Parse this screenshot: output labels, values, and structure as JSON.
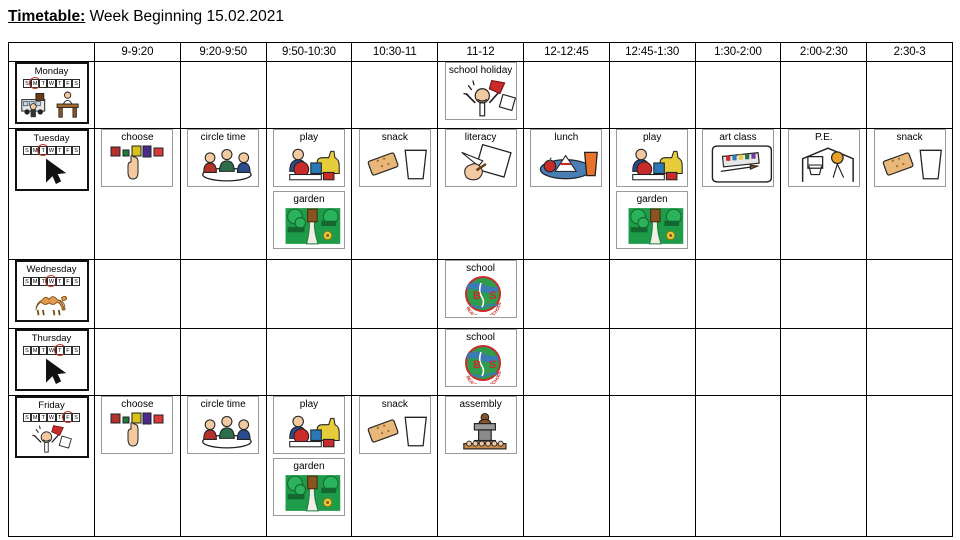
{
  "title": {
    "label": "Timetable:",
    "value": "Week Beginning 15.02.2021"
  },
  "table": {
    "corner_label": "",
    "time_slots": [
      "9-9:20",
      "9:20-9:50",
      "9:50-10:30",
      "10:30-11",
      "11-12",
      "12-12:45",
      "12:45-1:30",
      "1:30-2:00",
      "2:00-2:30",
      "2:30-3"
    ],
    "week_letters": [
      "S",
      "M",
      "T",
      "W",
      "T",
      "F",
      "S"
    ],
    "rows": [
      {
        "day": "Monday",
        "day_icon": "school-bus-and-desk-icon",
        "selected_letter_index": 1,
        "cells": [
          {
            "cards": []
          },
          {
            "cards": []
          },
          {
            "cards": []
          },
          {
            "cards": []
          },
          {
            "cards": [
              {
                "label": "school holiday",
                "icon": "celebration-icon"
              }
            ]
          },
          {
            "cards": []
          },
          {
            "cards": []
          },
          {
            "cards": []
          },
          {
            "cards": []
          },
          {
            "cards": []
          }
        ]
      },
      {
        "day": "Tuesday",
        "day_icon": "arrow-pointer-icon",
        "selected_letter_index": 2,
        "cells": [
          {
            "cards": [
              {
                "label": "choose",
                "icon": "choice-board-icon"
              }
            ]
          },
          {
            "cards": [
              {
                "label": "circle time",
                "icon": "children-circle-icon"
              }
            ]
          },
          {
            "cards": [
              {
                "label": "play",
                "icon": "toys-icon"
              },
              {
                "label": "garden",
                "icon": "garden-icon"
              }
            ]
          },
          {
            "cards": [
              {
                "label": "snack",
                "icon": "biscuit-and-drink-icon"
              }
            ]
          },
          {
            "cards": [
              {
                "label": "literacy",
                "icon": "writing-hand-icon"
              }
            ]
          },
          {
            "cards": [
              {
                "label": "lunch",
                "icon": "lunch-tray-icon"
              }
            ]
          },
          {
            "cards": [
              {
                "label": "play",
                "icon": "toys-icon"
              },
              {
                "label": "garden",
                "icon": "garden-icon"
              }
            ]
          },
          {
            "cards": [
              {
                "label": "art class",
                "icon": "paint-palette-icon"
              }
            ]
          },
          {
            "cards": [
              {
                "label": "P.E.",
                "icon": "basketball-hoop-icon"
              }
            ]
          },
          {
            "cards": [
              {
                "label": "snack",
                "icon": "biscuit-and-drink-icon"
              }
            ]
          }
        ]
      },
      {
        "day": "Wednesday",
        "day_icon": "camel-icon",
        "selected_letter_index": 3,
        "cells": [
          {
            "cards": []
          },
          {
            "cards": []
          },
          {
            "cards": []
          },
          {
            "cards": []
          },
          {
            "cards": [
              {
                "label": "school",
                "icon": "school-logo-icon"
              }
            ]
          },
          {
            "cards": []
          },
          {
            "cards": []
          },
          {
            "cards": []
          },
          {
            "cards": []
          },
          {
            "cards": []
          }
        ]
      },
      {
        "day": "Thursday",
        "day_icon": "arrow-pointer-icon",
        "selected_letter_index": 4,
        "cells": [
          {
            "cards": []
          },
          {
            "cards": []
          },
          {
            "cards": []
          },
          {
            "cards": []
          },
          {
            "cards": [
              {
                "label": "school",
                "icon": "school-logo-icon"
              }
            ]
          },
          {
            "cards": []
          },
          {
            "cards": []
          },
          {
            "cards": []
          },
          {
            "cards": []
          },
          {
            "cards": []
          }
        ]
      },
      {
        "day": "Friday",
        "day_icon": "celebration-icon",
        "selected_letter_index": 5,
        "cells": [
          {
            "cards": [
              {
                "label": "choose",
                "icon": "choice-board-icon"
              }
            ]
          },
          {
            "cards": [
              {
                "label": "circle time",
                "icon": "children-circle-icon"
              }
            ]
          },
          {
            "cards": [
              {
                "label": "play",
                "icon": "toys-icon"
              },
              {
                "label": "garden",
                "icon": "garden-icon"
              }
            ]
          },
          {
            "cards": [
              {
                "label": "snack",
                "icon": "biscuit-and-drink-icon"
              }
            ]
          },
          {
            "cards": [
              {
                "label": "assembly",
                "icon": "assembly-podium-icon"
              }
            ]
          },
          {
            "cards": []
          },
          {
            "cards": []
          },
          {
            "cards": []
          },
          {
            "cards": []
          },
          {
            "cards": []
          }
        ]
      }
    ]
  },
  "colors": {
    "grid_line": "#000000",
    "card_border": "#9a9a9a",
    "day_card_border": "#111111",
    "highlight_circle": "#c0392b",
    "garden_green": "#1e9c4a"
  }
}
